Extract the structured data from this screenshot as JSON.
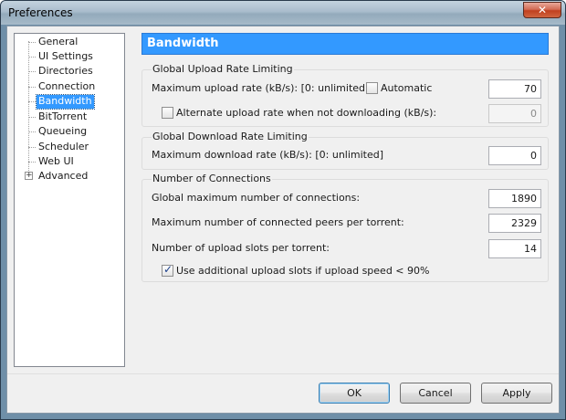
{
  "window": {
    "title": "Preferences",
    "close_glyph": "✕"
  },
  "tree": {
    "items": [
      {
        "label": "General"
      },
      {
        "label": "UI Settings"
      },
      {
        "label": "Directories"
      },
      {
        "label": "Connection"
      },
      {
        "label": "Bandwidth",
        "selected": true
      },
      {
        "label": "BitTorrent"
      },
      {
        "label": "Queueing"
      },
      {
        "label": "Scheduler"
      },
      {
        "label": "Web UI"
      },
      {
        "label": "Advanced",
        "expandable": true,
        "expander": "+"
      }
    ]
  },
  "panel": {
    "header": "Bandwidth",
    "upload": {
      "title": "Global Upload Rate Limiting",
      "max_label": "Maximum upload rate (kB/s): [0: unlimited]",
      "automatic_label": "Automatic",
      "automatic_checked": false,
      "max_value": "70",
      "alt_label": "Alternate upload rate when not downloading (kB/s):",
      "alt_checked": false,
      "alt_value": "0"
    },
    "download": {
      "title": "Global Download Rate Limiting",
      "max_label": "Maximum download rate (kB/s): [0: unlimited]",
      "max_value": "0"
    },
    "connections": {
      "title": "Number of Connections",
      "global_max_label": "Global maximum number of connections:",
      "global_max_value": "1890",
      "peers_label": "Maximum number of connected peers per torrent:",
      "peers_value": "2329",
      "slots_label": "Number of upload slots per torrent:",
      "slots_value": "14",
      "extra_slots_label": "Use additional upload slots if upload speed < 90%",
      "extra_slots_checked": true
    }
  },
  "buttons": {
    "ok": "OK",
    "cancel": "Cancel",
    "apply": "Apply"
  },
  "colors": {
    "accent": "#3399ff",
    "dialog_bg": "#f0f0f0"
  }
}
